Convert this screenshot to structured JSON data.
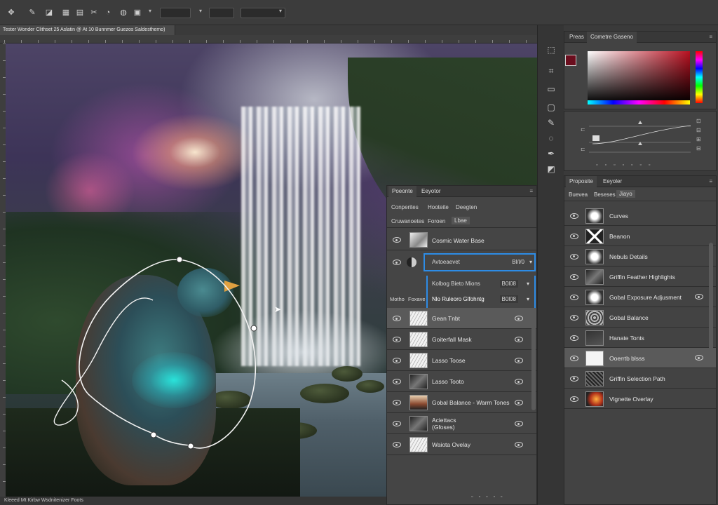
{
  "options_bar": {
    "field1": "",
    "field2": "",
    "field3": "",
    "field4": ""
  },
  "document": {
    "tab_title": "Tester Wonder Clithset 25 Aslatin @ At 10 Bunnmer Guezos Saldesthemo)",
    "status": "Kleeed  Mt Kirbw Wsdnitenizer Foots"
  },
  "color_panel": {
    "tab1": "Preas",
    "tab2": "Cometre Gaseno",
    "fg_color": "#6b0e1e",
    "bg_color": "#eeeeee"
  },
  "adjust_panel": {
    "tab1": "Proposite",
    "tab2": "Eeyoler",
    "sub1": "Buevea",
    "sub2": "Beseses",
    "sub3": "Jiayo"
  },
  "adjust_layers": [
    {
      "label": "Curves",
      "thumb": "feather"
    },
    {
      "label": "Beanon",
      "thumb": "cross"
    },
    {
      "label": "Nebuls Details",
      "thumb": "feather"
    },
    {
      "label": "Griffin Feather Highlights",
      "thumb": "dark"
    },
    {
      "label": "Gobal Exposure Adjusment",
      "thumb": "feather"
    },
    {
      "label": "Gobal Balance",
      "thumb": "texture"
    },
    {
      "label": "Hanate Tonts",
      "thumb": "curve"
    },
    {
      "label": "Ooerrtb blsss",
      "thumb": "white"
    },
    {
      "label": "Griffin Selection Path",
      "thumb": "dark-texture"
    },
    {
      "label": "Vignette Overlay",
      "thumb": "fire"
    }
  ],
  "layers_panel": {
    "tab1": "Poeonte",
    "tab2": "Eeyotor",
    "sub1": "Conperites",
    "sub2": "Hooteite",
    "sub3": "Deegten",
    "sub4": "Cruwanoetes",
    "sub5": "Foroen",
    "sub6": "Lbae",
    "top_layer": "Cosmic Water Base",
    "adj_name": "Avtoeaevet",
    "adj_value": "Bl/l/0",
    "blend1_label": "Kolbog Bieto Mions",
    "blend1_value": "B0l08",
    "blend2_label": "Nlo Ruleoro Glfohntg",
    "blend2_value": "B0l08",
    "mode1": "Motho",
    "mode2": "Foxave"
  },
  "layers": [
    {
      "label": "Gean Tnbt",
      "thumb": "sketch"
    },
    {
      "label": "Goiterfall Mask",
      "thumb": "sketch"
    },
    {
      "label": "Lasso Toose",
      "thumb": "sketch"
    },
    {
      "label": "Lasso Tooto",
      "thumb": "dark"
    },
    {
      "label": "Gobal Balance - Warm Tones",
      "thumb": "warm"
    },
    {
      "label": "Aciettacs\n(Gfoses)",
      "thumb": "dark"
    },
    {
      "label": "Waiota Ovelay",
      "thumb": "sketch"
    }
  ]
}
